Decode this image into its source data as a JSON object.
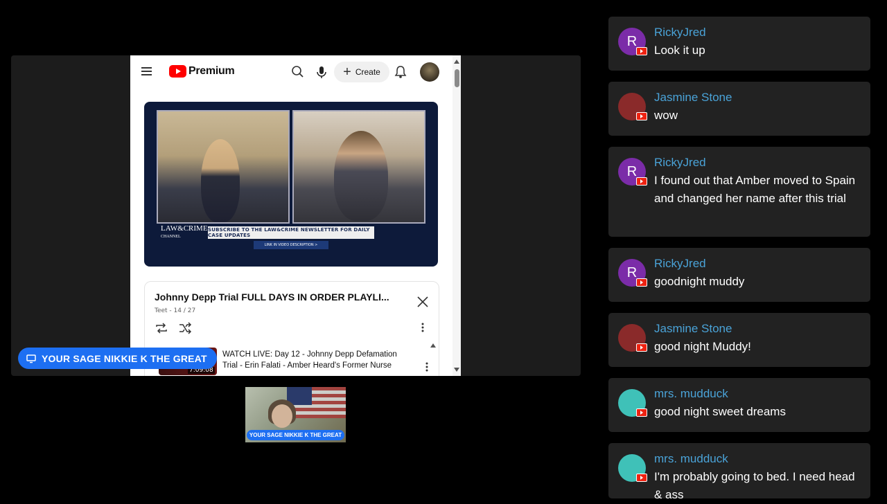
{
  "youtube": {
    "logo_text": "Premium",
    "create_label": "Create",
    "video": {
      "channel_logo": "LAW&CRIME",
      "channel_sub": "CHANNEL",
      "banner": "SUBSCRIBE TO THE LAW&CRIME NEWSLETTER FOR DAILY CASE UPDATES",
      "sub_banner": "LINK IN VIDEO DESCRIPTION >"
    },
    "playlist": {
      "title": "Johnny Depp Trial FULL DAYS IN ORDER PLAYLI...",
      "subtitle": "Teet - 14 / 27",
      "item": {
        "title": "WATCH LIVE: Day 12 - Johnny Depp Defamation Trial - Erin Falati - Amber Heard's Former Nurse",
        "duration": "7:09:08"
      }
    }
  },
  "stage_label": "YOUR SAGE NIKKIE K THE GREAT",
  "webcam_label": "YOUR SAGE NIKKIE K THE GREAT",
  "chat": {
    "messages": [
      {
        "name": "RickyJred",
        "text": "Look it up",
        "avatar": "R",
        "avatar_color": "#7b2ca8"
      },
      {
        "name": "Jasmine Stone",
        "text": "wow",
        "avatar": "",
        "avatar_color": "#8a2a2a"
      },
      {
        "name": "RickyJred",
        "text": "I found out that Amber moved to Spain and changed her name after this trial",
        "avatar": "R",
        "avatar_color": "#7b2ca8"
      },
      {
        "name": "RickyJred",
        "text": "goodnight muddy",
        "avatar": "R",
        "avatar_color": "#7b2ca8"
      },
      {
        "name": "Jasmine Stone",
        "text": "good night Muddy!",
        "avatar": "",
        "avatar_color": "#8a2a2a"
      },
      {
        "name": "mrs. mudduck",
        "text": "good night sweet dreams",
        "avatar": "",
        "avatar_color": "#3fc1b8"
      },
      {
        "name": "mrs. mudduck",
        "text": "I'm probably going to bed. I need head & ass",
        "avatar": "",
        "avatar_color": "#3fc1b8"
      }
    ]
  },
  "colors": {
    "accent_blue": "#1d6ff2",
    "chat_name": "#4aa3d8",
    "youtube_red": "#ff0000"
  }
}
